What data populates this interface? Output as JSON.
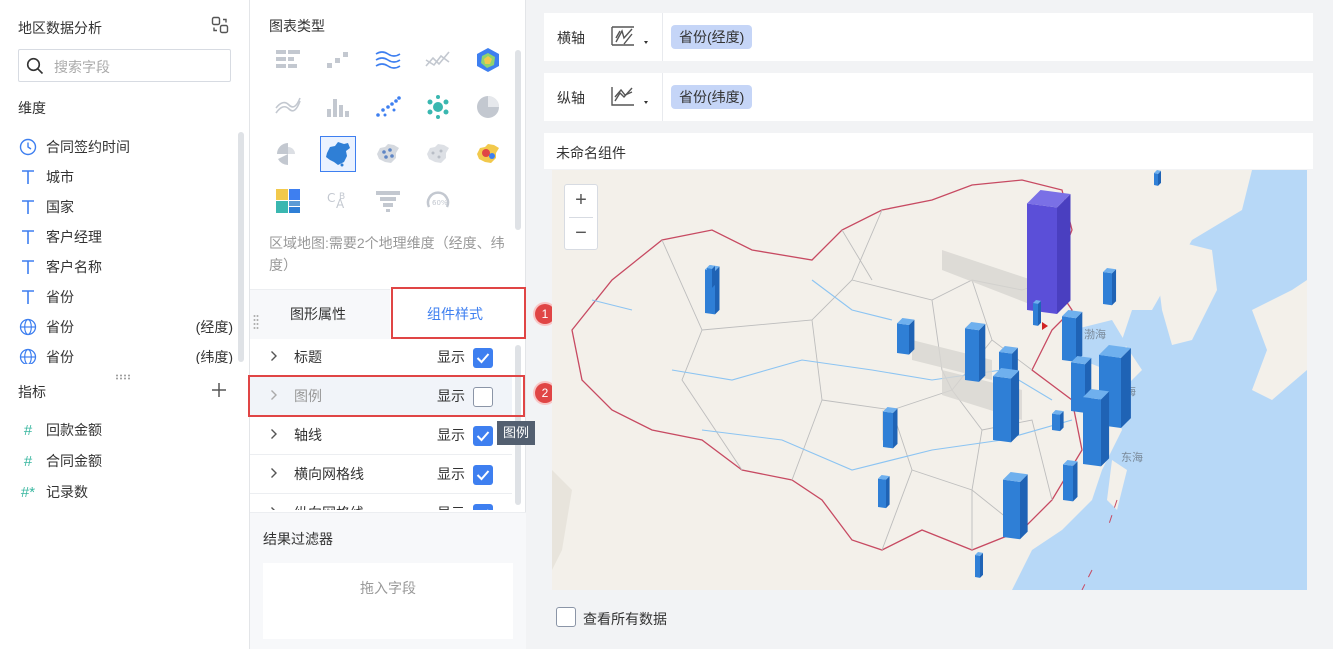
{
  "left_panel": {
    "title": "地区数据分析",
    "search_placeholder": "搜索字段",
    "dimensions_title": "维度",
    "dimensions": [
      {
        "label": "合同签约时间",
        "icon": "clock-icon",
        "sub": ""
      },
      {
        "label": "城市",
        "icon": "text-type-icon",
        "sub": ""
      },
      {
        "label": "国家",
        "icon": "text-type-icon",
        "sub": ""
      },
      {
        "label": "客户经理",
        "icon": "text-type-icon",
        "sub": ""
      },
      {
        "label": "客户名称",
        "icon": "text-type-icon",
        "sub": ""
      },
      {
        "label": "省份",
        "icon": "text-type-icon",
        "sub": ""
      },
      {
        "label": "省份",
        "icon": "globe-icon",
        "sub": "(经度)"
      },
      {
        "label": "省份",
        "icon": "globe-icon",
        "sub": "(纬度)"
      }
    ],
    "metrics_title": "指标",
    "metrics": [
      {
        "label": "回款金额",
        "icon": "hash-icon"
      },
      {
        "label": "合同金额",
        "icon": "hash-icon"
      },
      {
        "label": "记录数",
        "icon": "hash-star-icon"
      }
    ]
  },
  "middle_panel": {
    "chart_type_title": "图表类型",
    "chart_type_desc": "区域地图:需要2个地理维度（经度、纬度）",
    "tabs": [
      "图形属性",
      "组件样式"
    ],
    "props": [
      {
        "label": "标题",
        "show": "显示",
        "checked": true
      },
      {
        "label": "图例",
        "show": "显示",
        "checked": false
      },
      {
        "label": "轴线",
        "show": "显示",
        "checked": true
      },
      {
        "label": "横向网格线",
        "show": "显示",
        "checked": true
      },
      {
        "label": "纵向网格线",
        "show": "显示",
        "checked": true
      }
    ],
    "tooltip": "图例",
    "filter_title": "结果过滤器",
    "filter_drop": "拖入字段",
    "step_badges": [
      "1",
      "2"
    ]
  },
  "right_panel": {
    "x_axis_label": "横轴",
    "x_axis_field": "省份(经度)",
    "y_axis_label": "纵轴",
    "y_axis_field": "省份(纬度)",
    "component_title": "未命名组件",
    "zoom_in": "+",
    "zoom_out": "−",
    "map_labels": [
      "渤海",
      "黄海",
      "东海"
    ],
    "view_all_label": "查看所有数据"
  },
  "colors": {
    "accent": "#3e7ff0",
    "highlight": "#e04545",
    "bar_blue": "#2f7fd6",
    "bar_purple": "#5b4fd8",
    "sea": "#b7d8f7",
    "land": "#f3f0ea"
  }
}
